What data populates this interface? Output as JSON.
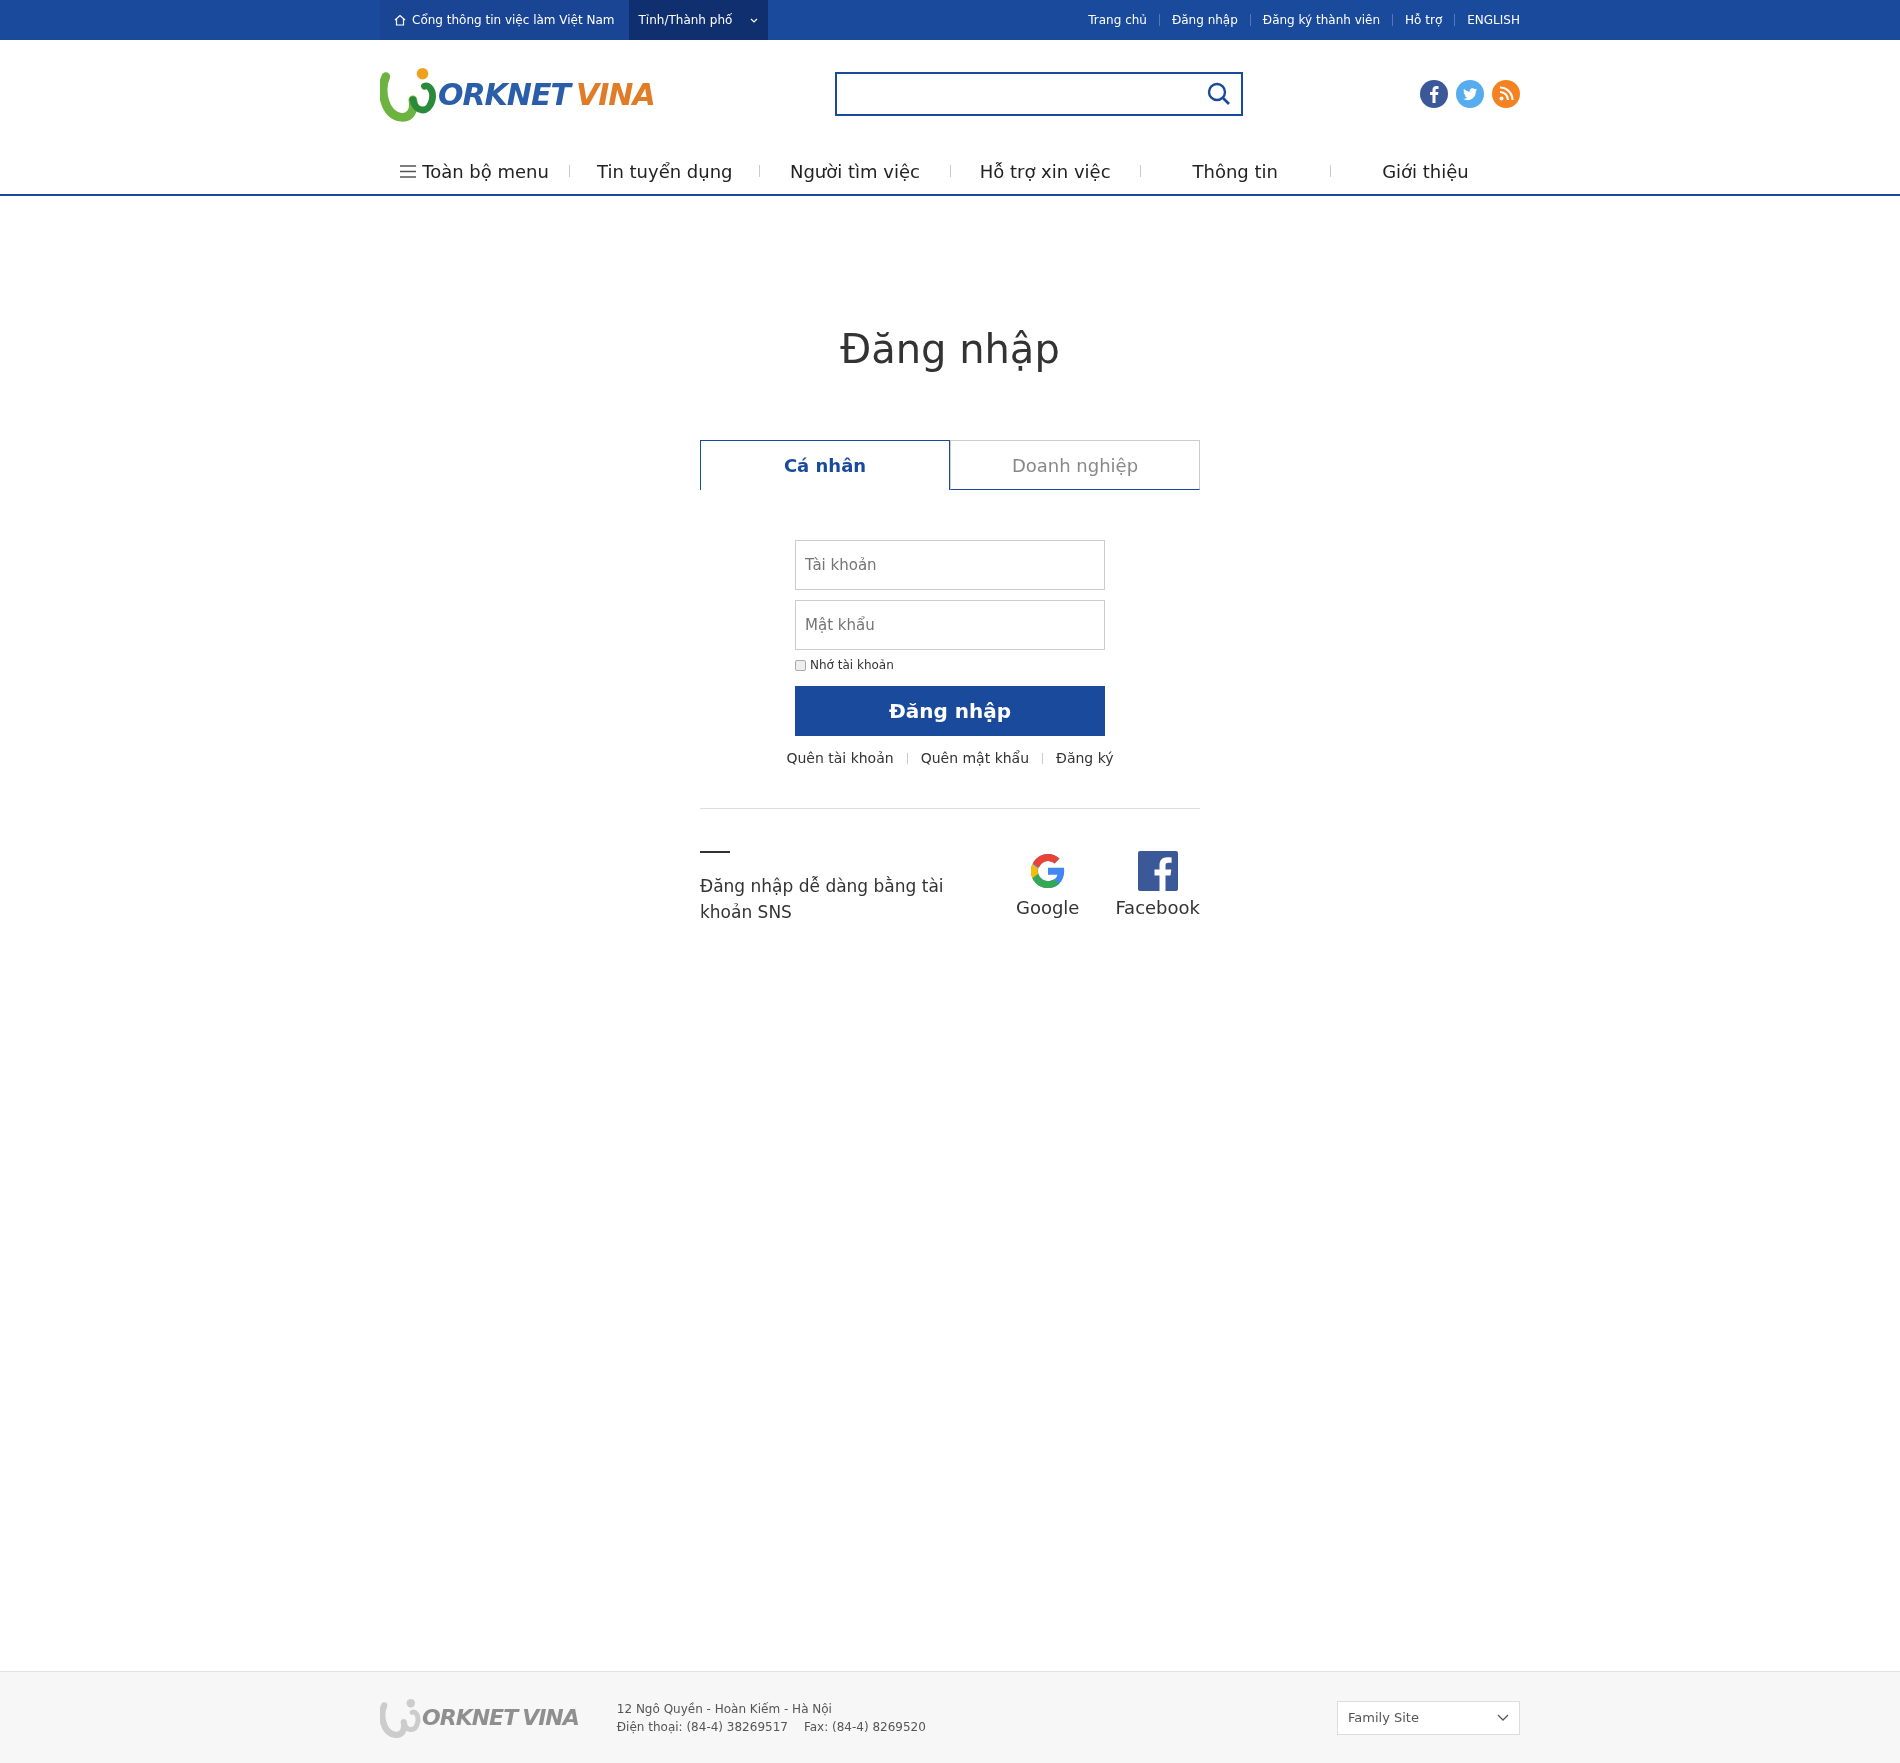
{
  "top_bar": {
    "portal": "Cổng thông tin việc làm Việt Nam",
    "region": "Tỉnh/Thành phố",
    "links": [
      "Trang chủ",
      "Đăng nhập",
      "Đăng ký thành viên",
      "Hỗ trợ",
      "ENGLISH"
    ]
  },
  "header": {
    "logo": {
      "part1": "ORKNET",
      "part2": "VINA"
    }
  },
  "nav": [
    {
      "label": "Toàn bộ menu",
      "kind": "menu"
    },
    {
      "label": "Tin tuyển dụng",
      "kind": "link"
    },
    {
      "label": "Người tìm việc",
      "kind": "link"
    },
    {
      "label": "Hỗ trợ xin việc",
      "kind": "link"
    },
    {
      "label": "Thông tin",
      "kind": "link"
    },
    {
      "label": "Giới thiệu",
      "kind": "link"
    }
  ],
  "login": {
    "title": "Đăng nhập",
    "tabs": [
      {
        "label": "Cá nhân",
        "selected": true
      },
      {
        "label": "Doanh nghiệp",
        "selected": false
      }
    ],
    "username": {
      "placeholder": "Tài khoản"
    },
    "password": {
      "placeholder": "Mật khẩu"
    },
    "remember": {
      "label": "Nhớ tài khoản",
      "checked": false
    },
    "submit": "Đăng nhập",
    "links": [
      "Quên tài khoản",
      "Quên mật khẩu",
      "Đăng ký"
    ],
    "sns": {
      "text": "Đăng nhập dễ dàng bằng tài khoản SNS",
      "providers": [
        {
          "label": "Google",
          "kind": "google"
        },
        {
          "label": "Facebook",
          "kind": "facebook"
        }
      ]
    }
  },
  "footer": {
    "logo": {
      "part1": "ORKNET",
      "part2": "VINA"
    },
    "address": "12 Ngô Quyền - Hoàn Kiếm - Hà Nội",
    "phone": "Điện thoại: (84-4) 38269517",
    "fax": "Fax: (84-4) 8269520",
    "family_site": "Family Site"
  }
}
